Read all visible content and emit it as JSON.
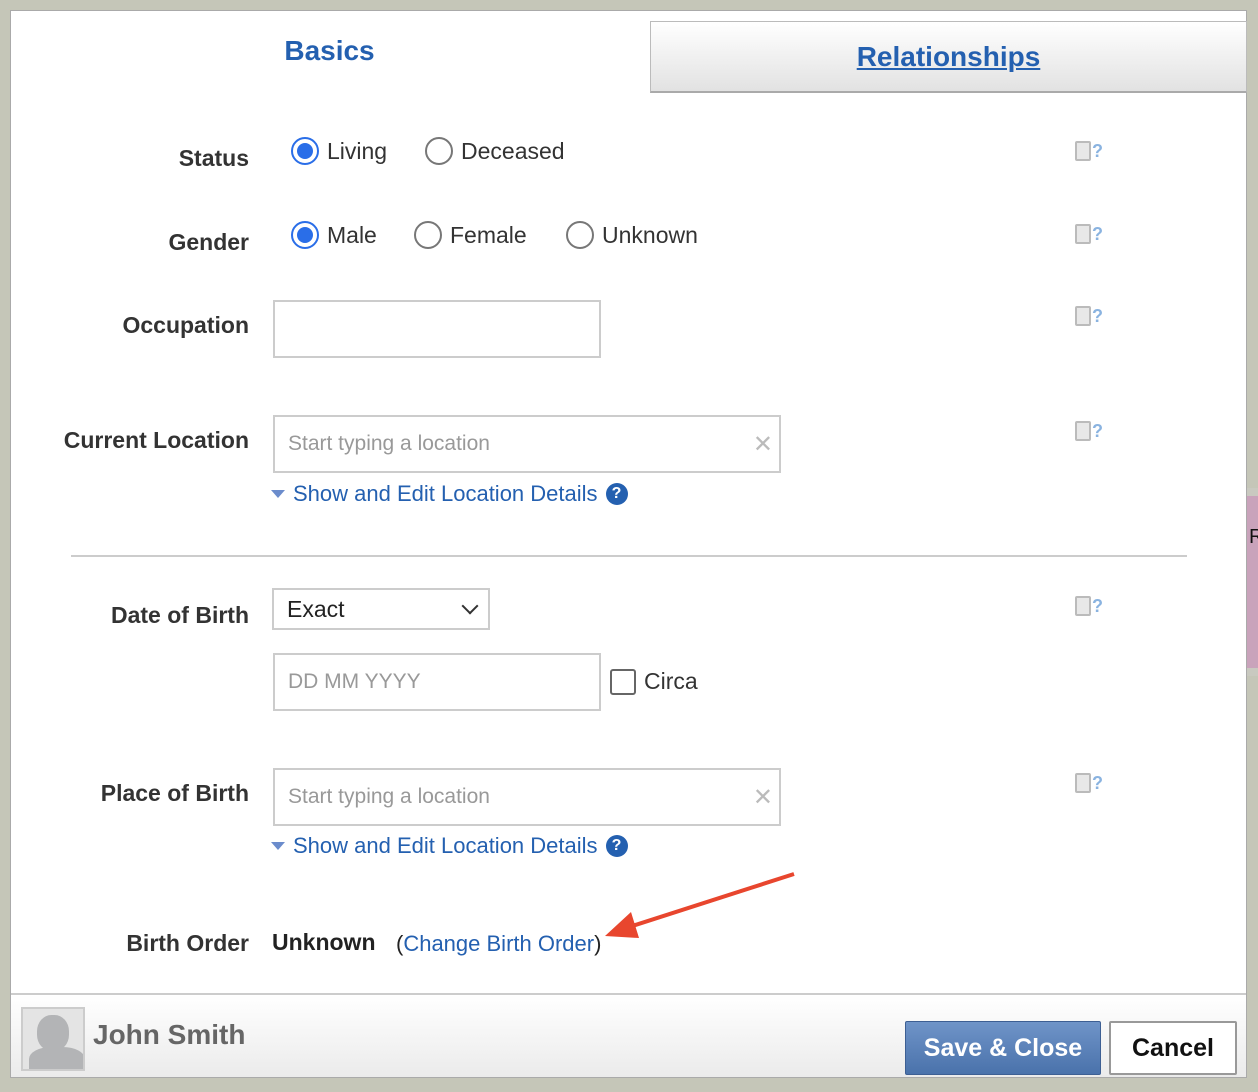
{
  "tabs": {
    "basics": "Basics",
    "relationships": "Relationships"
  },
  "form": {
    "status": {
      "label": "Status",
      "options": [
        "Living",
        "Deceased"
      ],
      "selected": "Living"
    },
    "gender": {
      "label": "Gender",
      "options": [
        "Male",
        "Female",
        "Unknown"
      ],
      "selected": "Male"
    },
    "occupation": {
      "label": "Occupation",
      "value": ""
    },
    "current_location": {
      "label": "Current Location",
      "placeholder": "Start typing a location",
      "details_link": "Show and Edit Location Details"
    },
    "date_of_birth": {
      "label": "Date of Birth",
      "type": "Exact",
      "placeholder": "DD MM YYYY",
      "circa": "Circa"
    },
    "place_of_birth": {
      "label": "Place of Birth",
      "placeholder": "Start typing a location",
      "details_link": "Show and Edit Location Details"
    },
    "birth_order": {
      "label": "Birth Order",
      "value": "Unknown",
      "open_paren": "(",
      "change_link": "Change Birth Order",
      "close_paren": ")"
    }
  },
  "help": {
    "icon": "note-help-icon",
    "mark": "?"
  },
  "background_panel": {
    "letter": "R"
  },
  "footer": {
    "name": "John Smith",
    "save": "Save & Close",
    "cancel": "Cancel"
  },
  "colors": {
    "accent": "#2460b0",
    "radio": "#2a6ee8",
    "annotation_arrow": "#e8462e"
  }
}
